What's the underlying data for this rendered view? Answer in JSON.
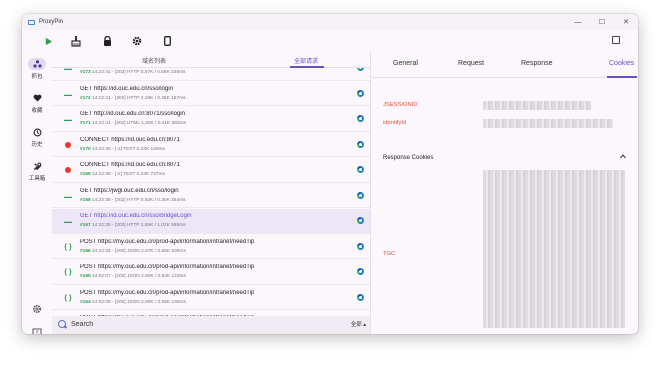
{
  "app": {
    "title": "ProxyPin"
  },
  "window_controls": {
    "minimize": "—",
    "maximize": "☐",
    "close": "✕"
  },
  "toolbar": {
    "icons": [
      "play-icon",
      "broom-icon",
      "lock-icon",
      "gear-icon",
      "phone-icon",
      "layout-icon"
    ]
  },
  "sidebar": {
    "items": [
      {
        "label": "抓包",
        "icon": "capture-icon",
        "active": true
      },
      {
        "label": "收藏",
        "icon": "heart-icon"
      },
      {
        "label": "历史",
        "icon": "history-icon"
      },
      {
        "label": "工具箱",
        "icon": "tools-icon"
      }
    ],
    "bottom_icons": [
      "settings-icon",
      "feedback-icon"
    ]
  },
  "list_tabs": {
    "domain_list": "域名列表",
    "all_requests": "全部请求"
  },
  "requests": [
    {
      "method": "GET",
      "url": "",
      "meta": "14:22:41 - [302]  HTTP 0.57K / 0.56K  235ms",
      "num": "#173"
    },
    {
      "method": "GET",
      "url": "GET https://id.ouc.edu.cn/sso/login",
      "meta": "14:22:41 - [302]  HTTP 2.18K / 0.36K  167ms",
      "num": "#172"
    },
    {
      "method": "GET",
      "url": "GET http://id.ouc.edu.cn:8071/sso/login",
      "meta": "14:22:41 - [302]  HTML 1.30K / 0.41K  593ms",
      "num": "#171"
    },
    {
      "method": "CONNECT",
      "url": "CONNECT https://id.ouc.edu.cn:8071",
      "meta": "14:22:40 - [-2]  TEXT 0.23K  149ms",
      "num": "#170"
    },
    {
      "method": "CONNECT",
      "url": "CONNECT https://id.ouc.edu.cn:8071",
      "meta": "14:22:39 - [-2]  TEXT 0.23K  737ms",
      "num": "#169"
    },
    {
      "method": "GET",
      "url": "GET https://jwgl.ouc.edu.cn/sso/login",
      "meta": "14:22:35 - [302]  HTTP 0.52K / 0.30K  354ms",
      "num": "#168"
    },
    {
      "method": "GET",
      "url": "GET https://id.ouc.edu.cn/sso/bridgeLogin",
      "meta": "14:22:35 - [302]  HTTP 1.55K / 1.02K  555ms",
      "num": "#167",
      "selected": true
    },
    {
      "method": "POST",
      "url": "POST https://my.ouc.edu.cn/prod-api/information/intranet/needTip",
      "meta": "14:22:34 - [200]  JSON 2.67K / 0.55K  639ms",
      "num": "#166"
    },
    {
      "method": "POST",
      "url": "POST https://my.ouc.edu.cn/prod-api/information/intranet/needTip",
      "meta": "14:02:07 - [200]  JSON 2.60K / 0.53K  123ms",
      "num": "#165"
    },
    {
      "method": "POST",
      "url": "POST https://my.ouc.edu.cn/prod-api/information/intranet/needTip",
      "meta": "14:02:05 - [200]  JSON 2.60K / 0.55K  135ms",
      "num": "#164"
    },
    {
      "method": "POST",
      "url": "POST https://my.ouc.edu.cn/prod-api/information/intranet/needTip",
      "meta": "",
      "num": ""
    }
  ],
  "search": {
    "placeholder": "Search",
    "filter": "全部 ▴"
  },
  "detail_tabs": {
    "general": "General",
    "request": "Request",
    "response": "Response",
    "cookies": "Cookies"
  },
  "cookies": {
    "request_cookies": [
      "JSESSIONID",
      "identifyId"
    ],
    "response_title": "Response Cookies",
    "response_cookies": [
      "TGC"
    ],
    "collapse_icon": "chevron-up-icon"
  },
  "colors": {
    "accent": "#6b50c4",
    "cookie_name": "#e0523a",
    "get": "#22a35a",
    "connect": "#e53935"
  }
}
